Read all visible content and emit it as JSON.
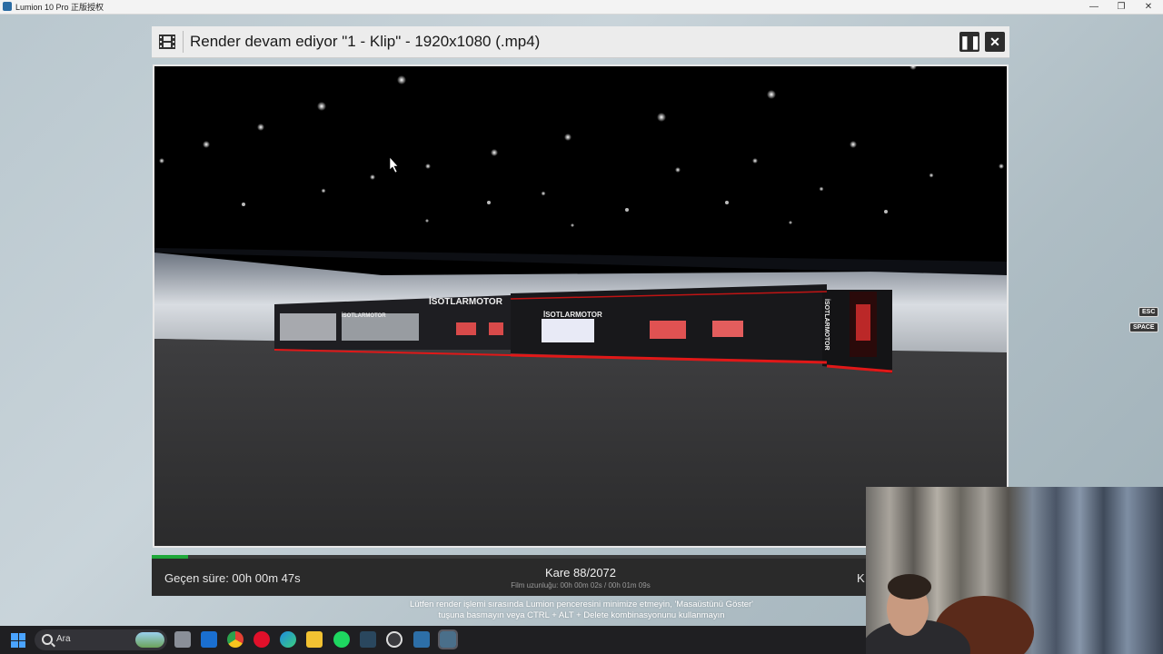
{
  "os_window": {
    "title": "Lumion 10 Pro 正版授权",
    "controls": [
      "—",
      "❐",
      "✕"
    ]
  },
  "dialog": {
    "title": "Render devam ediyor \"1 - Klip\" - 1920x1080 (.mp4)",
    "pause_label": "❚❚",
    "close_label": "✕",
    "progress": 0.042
  },
  "status": {
    "elapsed": "Geçen süre: 00h 00m 47s",
    "frame": "Kare 88/2072",
    "film_length": "Film uzunluğu: 00h 00m 02s / 00h 01m 09s",
    "right_partial": "K"
  },
  "warning": {
    "line1": "Lütfen render işlemi sırasında Lumion penceresini minimize etmeyin, 'Masaüstünü Göster'",
    "line2": "tuşuna basmayın veya CTRL + ALT + Delete kombinasyonunu kullanmayın"
  },
  "keys": {
    "esc": "ESC",
    "space": "SPACE"
  },
  "scene": {
    "brand": "İSOTLARMOTOR",
    "brand_vertical": "İSOTLARMOTOR"
  },
  "taskbar": {
    "search_placeholder": "Ara",
    "apps": [
      "task-view-icon",
      "outlook-icon",
      "chrome-icon",
      "opera-icon",
      "edge-icon",
      "file-explorer-icon",
      "spotify-icon",
      "steam-icon",
      "obs-icon",
      "app-3-icon",
      "lumion-icon"
    ]
  }
}
